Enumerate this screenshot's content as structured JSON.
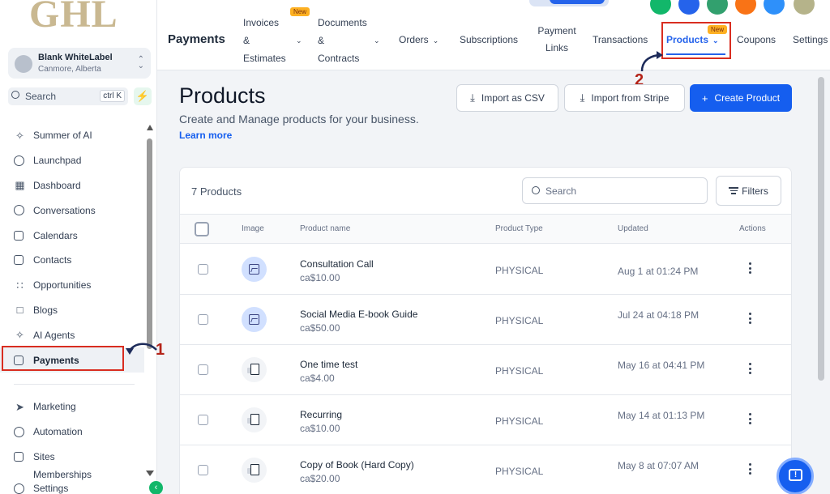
{
  "brand": {
    "logo_text": "GHL",
    "accent": "#155eef",
    "highlight": "#d92d20"
  },
  "account": {
    "name": "Blank WhiteLabel",
    "location": "Canmore, Alberta"
  },
  "sidebar": {
    "search_label": "Search",
    "search_shortcut": "ctrl K",
    "items": [
      {
        "label": "Summer of AI",
        "icon": "sparkle-icon"
      },
      {
        "label": "Launchpad",
        "icon": "rocket-icon"
      },
      {
        "label": "Dashboard",
        "icon": "dashboard-icon"
      },
      {
        "label": "Conversations",
        "icon": "chat-icon"
      },
      {
        "label": "Calendars",
        "icon": "calendar-icon"
      },
      {
        "label": "Contacts",
        "icon": "contacts-icon"
      },
      {
        "label": "Opportunities",
        "icon": "opportunities-icon"
      },
      {
        "label": "Blogs",
        "icon": "cube-icon"
      },
      {
        "label": "AI Agents",
        "icon": "sparkle-icon"
      },
      {
        "label": "Payments",
        "icon": "payments-icon"
      }
    ],
    "items2": [
      {
        "label": "Marketing",
        "icon": "send-icon"
      },
      {
        "label": "Automation",
        "icon": "automation-icon"
      },
      {
        "label": "Sites",
        "icon": "sites-icon"
      },
      {
        "label": "Memberships",
        "icon": "membership-icon"
      },
      {
        "label": "Settings",
        "icon": "gear-icon"
      }
    ]
  },
  "topnav": {
    "title": "Payments",
    "new_badge": "New",
    "tabs": {
      "invoices_1": "Invoices",
      "invoices_2": "&",
      "invoices_3": "Estimates",
      "documents_1": "Documents",
      "documents_2": "&",
      "documents_3": "Contracts",
      "orders": "Orders",
      "subscriptions": "Subscriptions",
      "payment_links_1": "Payment",
      "payment_links_2": "Links",
      "transactions": "Transactions",
      "products": "Products",
      "coupons": "Coupons",
      "settings": "Settings"
    }
  },
  "page": {
    "title": "Products",
    "subtitle": "Create and Manage products for your business.",
    "learn_more": "Learn more",
    "import_csv": "Import as CSV",
    "import_stripe": "Import from Stripe",
    "create_product": "Create Product"
  },
  "table": {
    "count": "7 Products",
    "search_placeholder": "Search",
    "filters": "Filters",
    "headers": {
      "image": "Image",
      "name": "Product name",
      "type": "Product Type",
      "updated": "Updated",
      "actions": "Actions"
    },
    "rows": [
      {
        "name": "Consultation Call",
        "price": "ca$10.00",
        "type": "PHYSICAL",
        "updated": "Aug 1 at 01:24 PM",
        "image": "placeholder"
      },
      {
        "name": "Social Media E-book Guide",
        "price": "ca$50.00",
        "type": "PHYSICAL",
        "updated": "Jul 24 at 04:18 PM",
        "image": "placeholder"
      },
      {
        "name": "One time test",
        "price": "ca$4.00",
        "type": "PHYSICAL",
        "updated": "May 16 at 04:41 PM",
        "image": "photo"
      },
      {
        "name": "Recurring",
        "price": "ca$10.00",
        "type": "PHYSICAL",
        "updated": "May 14 at 01:13 PM",
        "image": "photo"
      },
      {
        "name": "Copy of Book (Hard Copy)",
        "price": "ca$20.00",
        "type": "PHYSICAL",
        "updated": "May 8 at 07:07 AM",
        "image": "photo"
      }
    ]
  },
  "annotations": {
    "step1": "1",
    "step2": "2"
  }
}
